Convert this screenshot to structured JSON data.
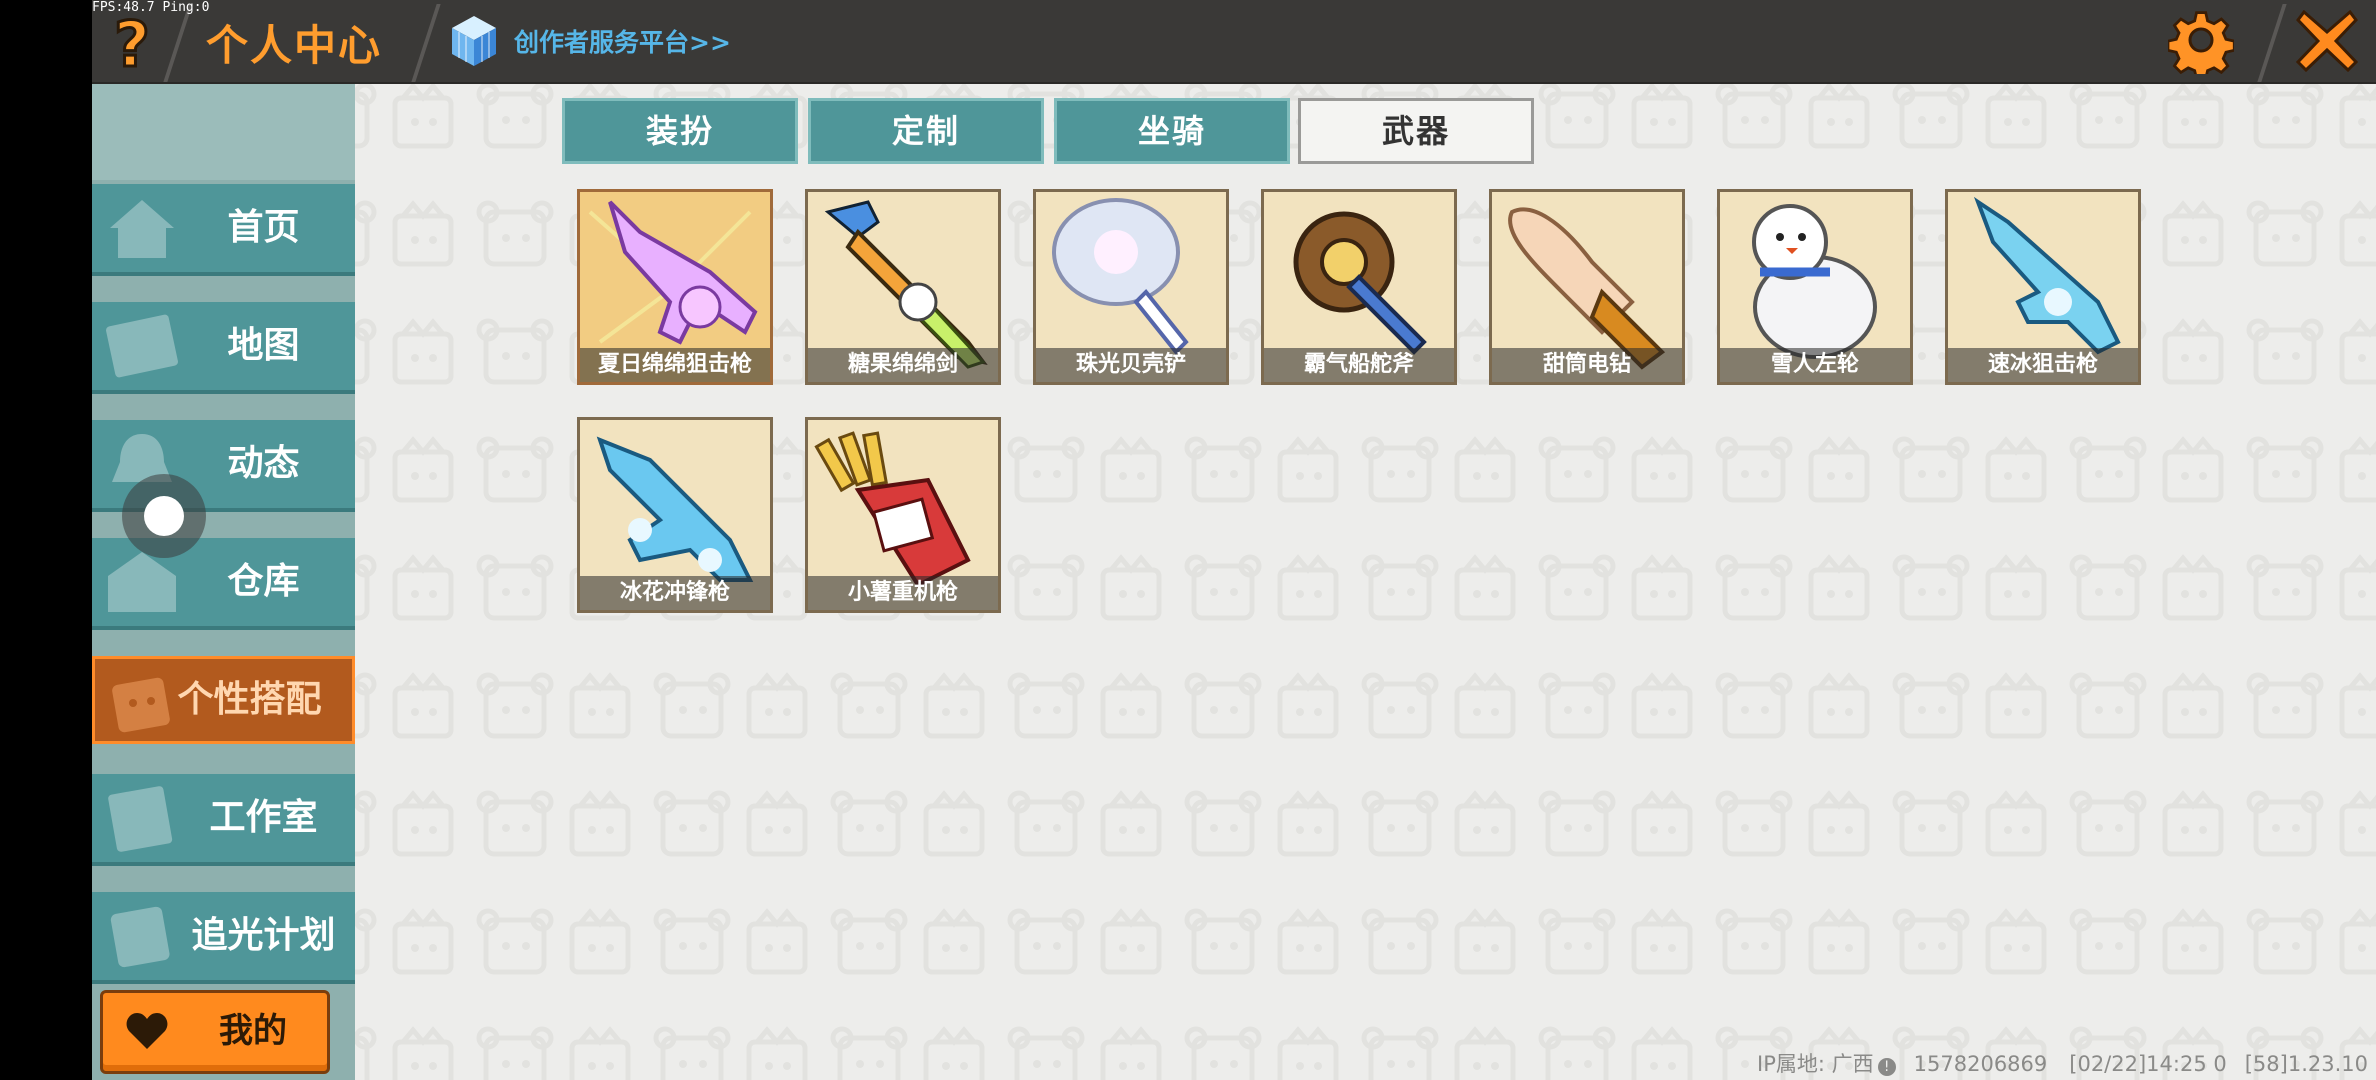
{
  "status": {
    "fps": "FPS:48.7",
    "ping": "Ping:0"
  },
  "header": {
    "title": "个人中心",
    "creator_link": "创作者服务平台>>"
  },
  "sidebar": {
    "items": [
      {
        "label": "首页",
        "icon": "home-icon"
      },
      {
        "label": "地图",
        "icon": "map-icon"
      },
      {
        "label": "动态",
        "icon": "bell-icon"
      },
      {
        "label": "仓库",
        "icon": "warehouse-icon"
      },
      {
        "label": "个性搭配",
        "icon": "character-icon",
        "active": true
      },
      {
        "label": "工作室",
        "icon": "studio-icon"
      },
      {
        "label": "追光计划",
        "icon": "badge-icon"
      }
    ],
    "mine_button": "我的"
  },
  "tabs": [
    {
      "label": "装扮"
    },
    {
      "label": "定制"
    },
    {
      "label": "坐骑"
    },
    {
      "label": "武器",
      "active": true
    }
  ],
  "items": [
    {
      "name": "夏日绵绵狙击枪"
    },
    {
      "name": "糖果绵绵剑"
    },
    {
      "name": "珠光贝壳铲"
    },
    {
      "name": "霸气船舵斧"
    },
    {
      "name": "甜筒电钻"
    },
    {
      "name": "雪人左轮"
    },
    {
      "name": "速冰狙击枪"
    },
    {
      "name": "冰花冲锋枪"
    },
    {
      "name": "小薯重机枪"
    }
  ],
  "footer": {
    "ip_location": "IP属地: 广西",
    "user_id": "1578206869",
    "datetime": "[02/22]14:25 0",
    "version": "[58]1.23.10"
  },
  "colors": {
    "accent": "#ff9d2e",
    "teal": "#4f9699",
    "link": "#56b6e8"
  }
}
